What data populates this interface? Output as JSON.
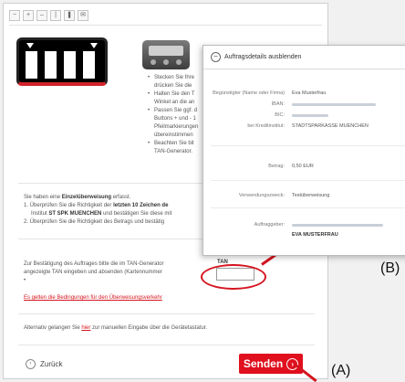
{
  "colors": {
    "accent_red": "#e0101e",
    "link_red": "#d51520",
    "panel_bg": "#ffffff",
    "page_bg": "#f1f1f1"
  },
  "toolbar": {
    "icons": [
      "zoom-out-icon",
      "zoom-in-icon",
      "minus-icon",
      "bar-icon",
      "pause-icon",
      "mail-icon"
    ]
  },
  "instructions": [
    "Stecken Sie Ihre",
    "drücken Sie die",
    "Halten Sie den T",
    "Winkel an die an",
    "Passen Sie ggf. d",
    "Buttons + und - 1",
    "Pfeilmarkierungen",
    "übereinstimmen",
    "Beachten Sie bit",
    "TAN-Generator."
  ],
  "info": {
    "intro_prefix": "Sie haben eine ",
    "intro_bold": "Einzelüberweisung",
    "intro_suffix": " erfasst.",
    "step1_prefix": "1. Überprüfen Sie die Richtigkeit der ",
    "step1_bold": "letzten 10 Zeichen de",
    "step2_prefix": "Institut ",
    "step2_bold": "ST SPK MUENCHEN",
    "step2_suffix": " und bestätigen Sie diese mit",
    "step3": "2. Überprüfen Sie die Richtigkeit des Betrags und bestätig"
  },
  "confirm": {
    "line1": "Zur Bestätigung des Auftrages bitte die im TAN-Generator",
    "line2": "angezeigte TAN eingeben und absenden (Kartennummer",
    "line3": "•",
    "tan_label": "TAN",
    "tan_value": ""
  },
  "conditions_link": "Es gelten die Bedingungen für den Überweisungsverkehr",
  "alternative": {
    "prefix": "Alternativ gelangen Sie ",
    "link": "hier",
    "suffix": " zur manuellen Eingabe über die Gerätetastatur."
  },
  "actions": {
    "back_label": "Zurück",
    "send_label": "Senden"
  },
  "callouts": {
    "a": "(A)",
    "b": "(B)"
  },
  "popup": {
    "header": "Auftragsdetails ausblenden",
    "recipient_label": "Begünstigter (Name oder Firma)",
    "recipient_value": "Eva Musterfrau",
    "iban_label": "IBAN:",
    "bic_label": "BIC:",
    "institute_label": "bei Kreditinstitut:",
    "institute_value": "STADTSPARKASSE MUENCHEN",
    "amount_label": "Betrag:",
    "amount_value": "0,50 EUR",
    "purpose_label": "Verwendungszweck:",
    "purpose_value": "Testüberweisung",
    "payer_label": "Auftraggeber:",
    "payer_name": "EVA MUSTERFRAU"
  }
}
